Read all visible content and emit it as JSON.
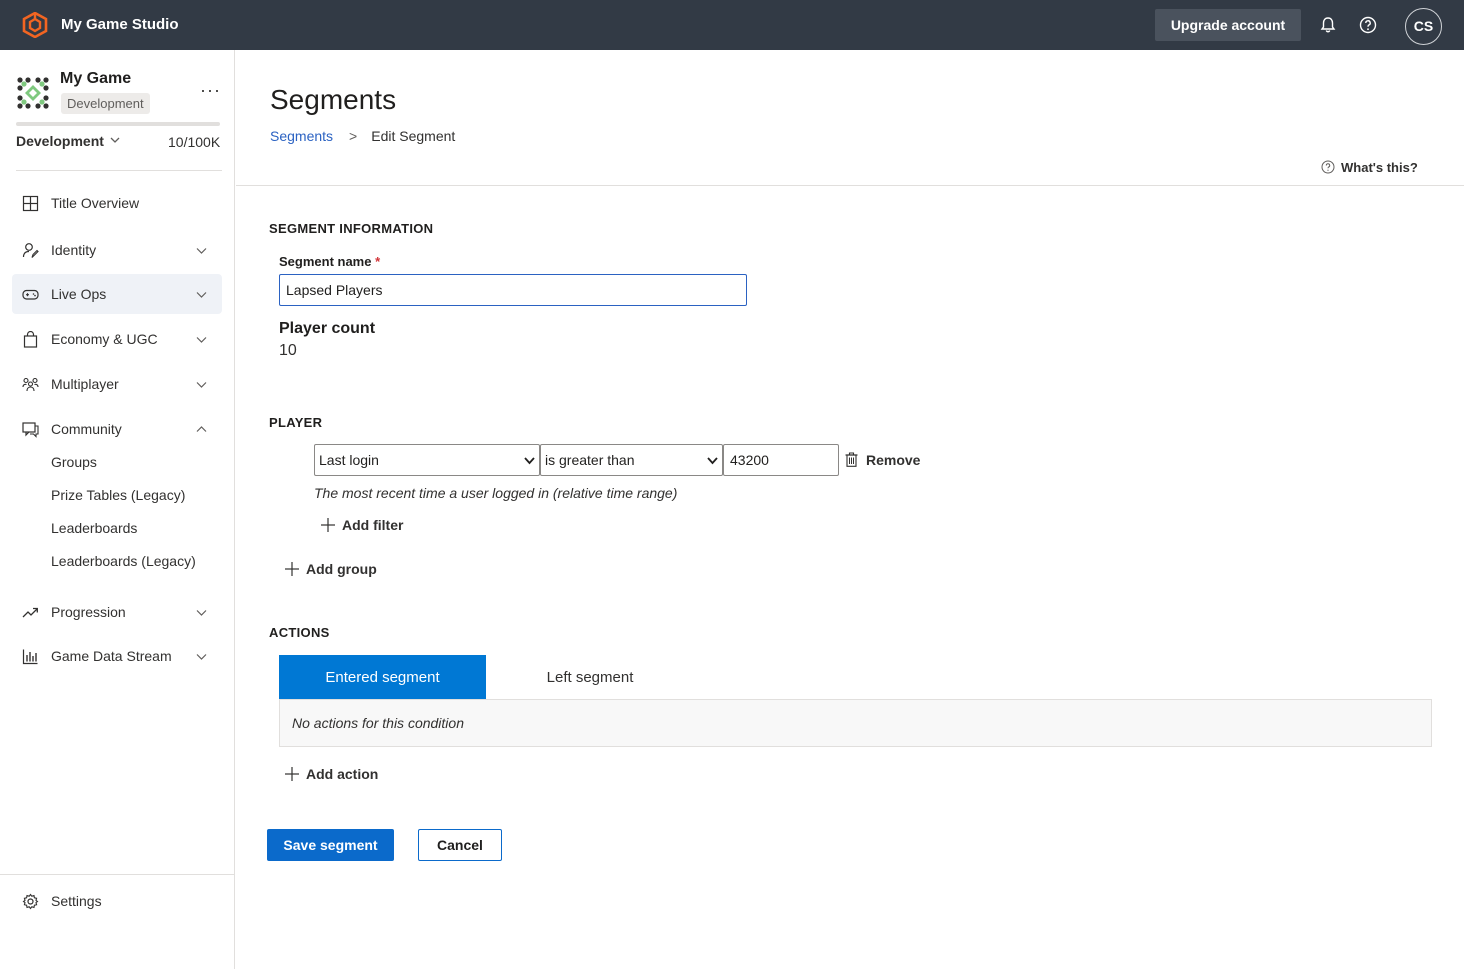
{
  "app": {
    "title": "My Game Studio"
  },
  "topbar": {
    "upgrade_label": "Upgrade account",
    "user_initials": "CS",
    "icons": [
      "bell-icon",
      "help-icon"
    ]
  },
  "sidebar": {
    "game_name": "My Game",
    "environment_badge": "Development",
    "more_label": "···",
    "environment_select": "Development",
    "usage_text": "10/100K",
    "usage_fraction": 0.0001,
    "items": [
      {
        "label": "Title Overview",
        "icon": "grid-icon"
      },
      {
        "label": "Identity",
        "icon": "identity-icon"
      },
      {
        "label": "Live Ops",
        "icon": "gamepad-icon",
        "active": true
      },
      {
        "label": "Economy & UGC",
        "icon": "shopping-bag-icon"
      },
      {
        "label": "Multiplayer",
        "icon": "people-icon"
      },
      {
        "label": "Community",
        "icon": "chat-icon",
        "expanded": true
      },
      {
        "label": "Progression",
        "icon": "trend-icon"
      },
      {
        "label": "Game Data Stream",
        "icon": "bar-chart-icon"
      }
    ],
    "community_children": [
      "Groups",
      "Prize Tables (Legacy)",
      "Leaderboards",
      "Leaderboards (Legacy)"
    ],
    "settings_label": "Settings"
  },
  "main": {
    "title": "Segments",
    "breadcrumb": {
      "link": "Segments",
      "separator": ">",
      "current": "Edit Segment"
    },
    "whats_this": "What's this?",
    "segment_info_heading": "SEGMENT INFORMATION",
    "segment_name_label": "Segment name",
    "required_marker": "*",
    "segment_name_value": "Lapsed Players",
    "player_count_label": "Player count",
    "player_count_value": "10",
    "player_heading": "PLAYER",
    "filter": {
      "property": "Last login",
      "operator": "is greater than",
      "value": "43200",
      "remove_label": "Remove",
      "description": "The most recent time a user logged in (relative time range)"
    },
    "add_filter_label": "Add filter",
    "add_group_label": "Add group",
    "actions_heading": "ACTIONS",
    "tabs": [
      {
        "label": "Entered segment",
        "selected": true
      },
      {
        "label": "Left segment",
        "selected": false
      }
    ],
    "no_actions_text": "No actions for this condition",
    "add_action_label": "Add action",
    "save_label": "Save segment",
    "cancel_label": "Cancel"
  },
  "colors": {
    "topbar_bg": "#323a45",
    "accent": "#0078d4",
    "primary_button": "#0b6acb",
    "link": "#2b62c2",
    "logo_orange": "#f26522"
  }
}
